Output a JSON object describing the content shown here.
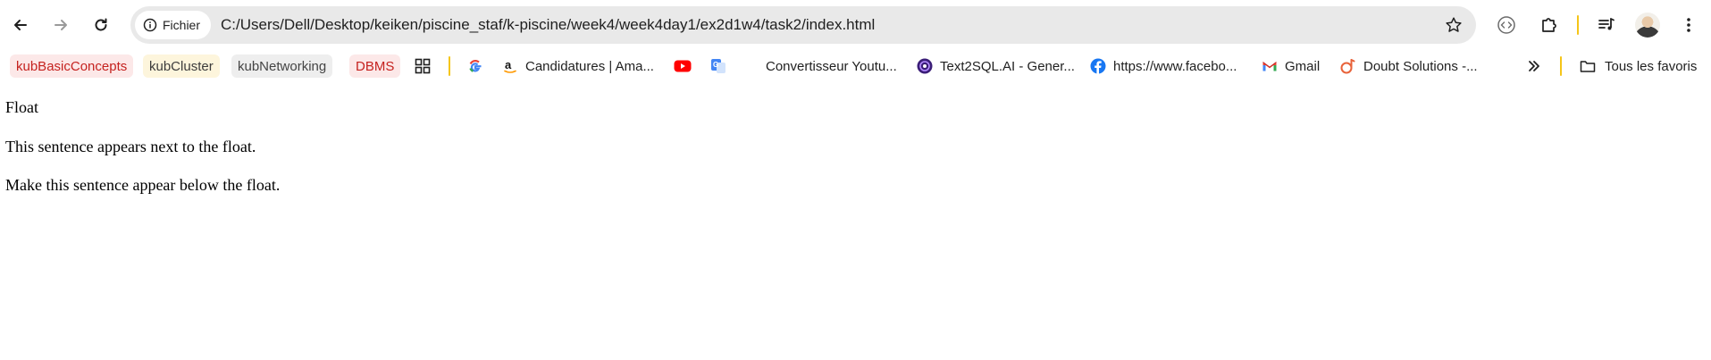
{
  "toolbar": {
    "site_info_label": "Fichier",
    "url": "C:/Users/Dell/Desktop/keiken/piscine_staf/k-piscine/week4/week4day1/ex2d1w4/task2/index.html"
  },
  "bookmarks": [
    {
      "label": "kubBasicConcepts",
      "style": "red"
    },
    {
      "label": "kubCluster",
      "style": "yellow"
    },
    {
      "label": "kubNetworking",
      "style": "grey"
    },
    {
      "label": "DBMS",
      "style": "red"
    },
    {
      "label": "Candidatures | Ama...",
      "icon": "amazon-icon"
    },
    {
      "label": "Convertisseur Youtu...",
      "icon": "translate-icon"
    },
    {
      "label": "Text2SQL.AI - Gener...",
      "icon": "text2sql-icon"
    },
    {
      "label": "https://www.facebo...",
      "icon": "facebook-icon"
    },
    {
      "label": "Gmail",
      "icon": "gmail-icon"
    },
    {
      "label": "Doubt Solutions -...",
      "icon": "doubt-icon"
    },
    {
      "label": "Tous les favoris",
      "icon": "folder-icon"
    }
  ],
  "page": {
    "float_label": "Float",
    "sentence_next": "This sentence appears next to the float.",
    "sentence_below": "Make this sentence appear below the float."
  },
  "colors": {
    "omnibox_bg": "#e9e9e9",
    "separator_yellow": "#f5c518",
    "tag_red_text": "#c5221f"
  }
}
